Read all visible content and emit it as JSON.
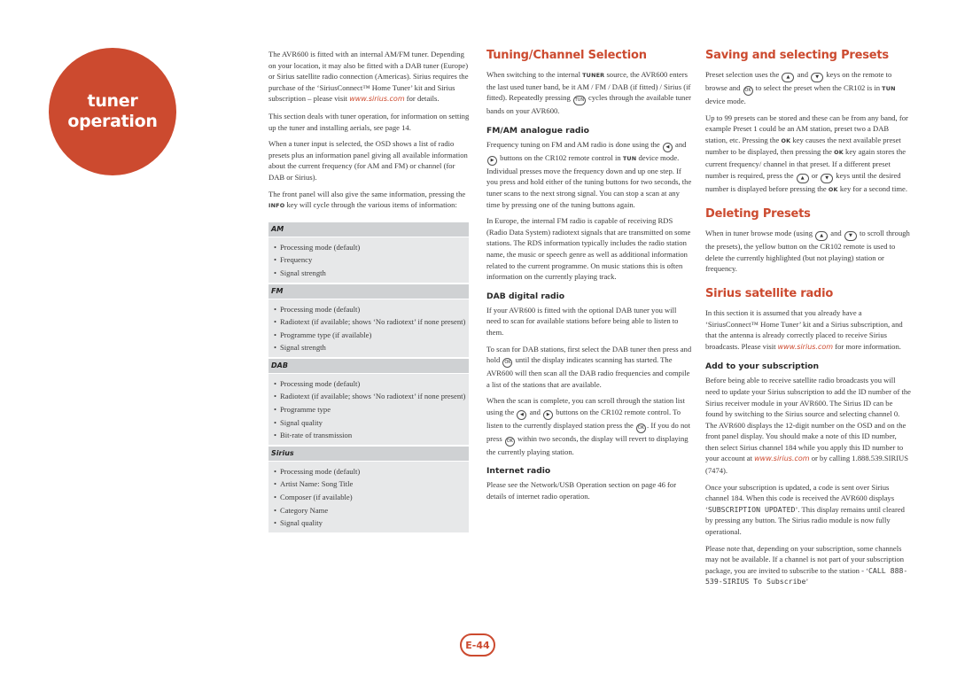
{
  "section_badge": {
    "line1": "tuner",
    "line2": "operation"
  },
  "col1": {
    "intro_p1_a": "The AVR600 is fitted with an internal AM/FM tuner. Depending on your location, it may also be fitted with a DAB tuner (Europe) or Sirius satellite radio connection (Americas). Sirius requires the purchase of the ‘SiriusConnect™ Home Tuner’ kit and Sirius subscription – please visit ",
    "intro_p1_link": "www.sirius.com",
    "intro_p1_b": " for details.",
    "intro_p2": "This section deals with tuner operation, for information on setting up the tuner and installing aerials, see page 14.",
    "intro_p3": "When a tuner input is selected, the OSD shows a list of radio presets plus an information panel giving all available information about the current frequency (for AM and FM) or channel (for DAB or Sirius).",
    "intro_p4_a": "The front panel will also give the same information, pressing the ",
    "intro_p4_key": "INFO",
    "intro_p4_b": " key will cycle through the various items of information:",
    "table": [
      {
        "band": "AM",
        "items": [
          "Processing mode (default)",
          "Frequency",
          "Signal strength"
        ]
      },
      {
        "band": "FM",
        "items": [
          "Processing mode (default)",
          "Radiotext (if available; shows ‘No radiotext’ if none present)",
          "Programme type (if available)",
          "Signal strength"
        ]
      },
      {
        "band": "DAB",
        "items": [
          "Processing mode (default)",
          "Radiotext (if available; shows ‘No radiotext’ if none present)",
          "Programme type",
          "Signal quality",
          "Bit-rate of transmission"
        ]
      },
      {
        "band": "Sirius",
        "items": [
          "Processing mode (default)",
          "Artist Name: Song Title",
          "Composer (if available)",
          "Category Name",
          "Signal quality"
        ]
      }
    ]
  },
  "col2": {
    "title": "Tuning/Channel Selection",
    "p1_a": "When switching to the internal ",
    "p1_key": "TUNER",
    "p1_b": " source, the AVR600 enters the last used tuner band, be it AM / FM / DAB (if fitted) / Sirius (if fitted). Repeatedly pressing ",
    "p1_btn": "TUN",
    "p1_c": " cycles through the available tuner bands on your AVR600.",
    "fm_heading": "FM/AM analogue radio",
    "fm_p1_a": "Frequency tuning on FM and AM radio is done using the ",
    "fm_p1_b": " and ",
    "fm_p1_c": " buttons on the CR102 remote control in ",
    "fm_p1_key": "TUN",
    "fm_p1_d": " device mode. Individual presses move the frequency down and up one step. If you press and hold either of the tuning buttons for two seconds, the tuner scans to the next strong signal. You can stop a scan at any time by pressing one of the tuning buttons again.",
    "fm_p2": "In Europe, the internal FM radio is capable of receiving RDS (Radio Data System) radiotext signals that are transmitted on some stations. The RDS information typically includes the radio station name, the music or speech genre as well as additional information related to the current programme. On music stations this is often information on the currently playing track.",
    "dab_heading": "DAB digital radio",
    "dab_p1": "If your AVR600 is fitted with the optional DAB tuner you will need to scan for available stations before being able to listen to them.",
    "dab_p2_a": "To scan for DAB stations, first select the DAB tuner then press and hold ",
    "dab_p2_b": " until the display indicates scanning has started. The AVR600 will then scan all the DAB radio frequencies and compile a list of the stations that are available.",
    "dab_p3_a": "When the scan is complete, you can scroll through the station list using the ",
    "dab_p3_b": " and ",
    "dab_p3_c": " buttons on the CR102 remote control. To listen to the currently displayed station press the ",
    "dab_p3_d": ". If you do not press ",
    "dab_p3_e": " within two seconds, the display will revert to displaying the currently playing station.",
    "net_heading": "Internet radio",
    "net_p1": "Please see the Network/USB Operation section on page 46 for details of internet radio operation.",
    "ok_btn": "OK",
    "left_btn": "◀",
    "right_btn": "▶"
  },
  "col3": {
    "presets_title": "Saving and selecting Presets",
    "presets_p1_a": "Preset selection uses the ",
    "presets_p1_b": " and ",
    "presets_p1_c": " keys on the remote to browse and ",
    "presets_p1_d": " to select the preset when the CR102 is in ",
    "presets_p1_key": "TUN",
    "presets_p1_e": " device mode.",
    "presets_p2_a": "Up to 99 presets can be stored and these can be from any band, for example Preset 1 could be an AM station, preset two a DAB station, etc. Pressing the ",
    "presets_p2_b": " key causes the next available preset number to be displayed, then pressing the ",
    "presets_p2_c": " key again stores the current frequency/ channel in that preset. If a different preset number is required, press the ",
    "presets_p2_d": " or ",
    "presets_p2_e": " keys until the desired number is displayed before pressing the ",
    "presets_p2_f": " key for a second time.",
    "ok_key": "OK",
    "up_btn": "▲",
    "down_btn": "▼",
    "ok_btn": "OK",
    "delete_title": "Deleting Presets",
    "delete_p1_a": "When in tuner browse mode (using ",
    "delete_p1_b": " and ",
    "delete_p1_c": " to scroll through the presets), the yellow button on the CR102 remote is used to delete the currently highlighted (but not playing) station or frequency.",
    "sirius_title": "Sirius satellite radio",
    "sirius_p1_a": "In this section it is assumed that you already have a ‘SiriusConnect™ Home Tuner’ kit and a Sirius subscription, and that the antenna is already correctly placed to receive Sirius broadcasts. Please visit ",
    "sirius_link": "www.sirius.com",
    "sirius_p1_b": " for more information.",
    "sub_heading": "Add to your subscription",
    "sub_p1_a": "Before being able to receive satellite radio broadcasts you will need to update your Sirius subscription to add the ID number of the Sirius receiver module in your AVR600. The Sirius ID can be found by switching to the Sirius source and selecting channel 0. The AVR600 displays the 12-digit number on the OSD and on the front panel display. You should make a note of this ID number, then select Sirius channel 184 while you apply this ID number to your account at ",
    "sub_p1_b": " or by calling 1.888.539.SIRIUS (7474).",
    "sub_p2_a": "Once your subscription is updated, a code is sent over Sirius channel 184. When this code is received the AVR600 displays ‘",
    "sub_p2_lcd": "SUBSCRIPTION UPDATED",
    "sub_p2_b": "’. This display remains until cleared by pressing any button. The Sirius radio module is now fully operational.",
    "sub_p3_a": "Please note that, depending on your subscription, some channels may not be available. If a channel is not part of your subscription package, you are invited to subscribe to the station - ‘",
    "sub_p3_lcd": "CALL 888-539-SIRIUS To Subscribe",
    "sub_p3_b": "’"
  },
  "page_number": "E-44",
  "colors": {
    "accent": "#cc4a2f",
    "table_header": "#cfd1d3",
    "table_body": "#e7e8e9",
    "text": "#3a3a3a"
  }
}
